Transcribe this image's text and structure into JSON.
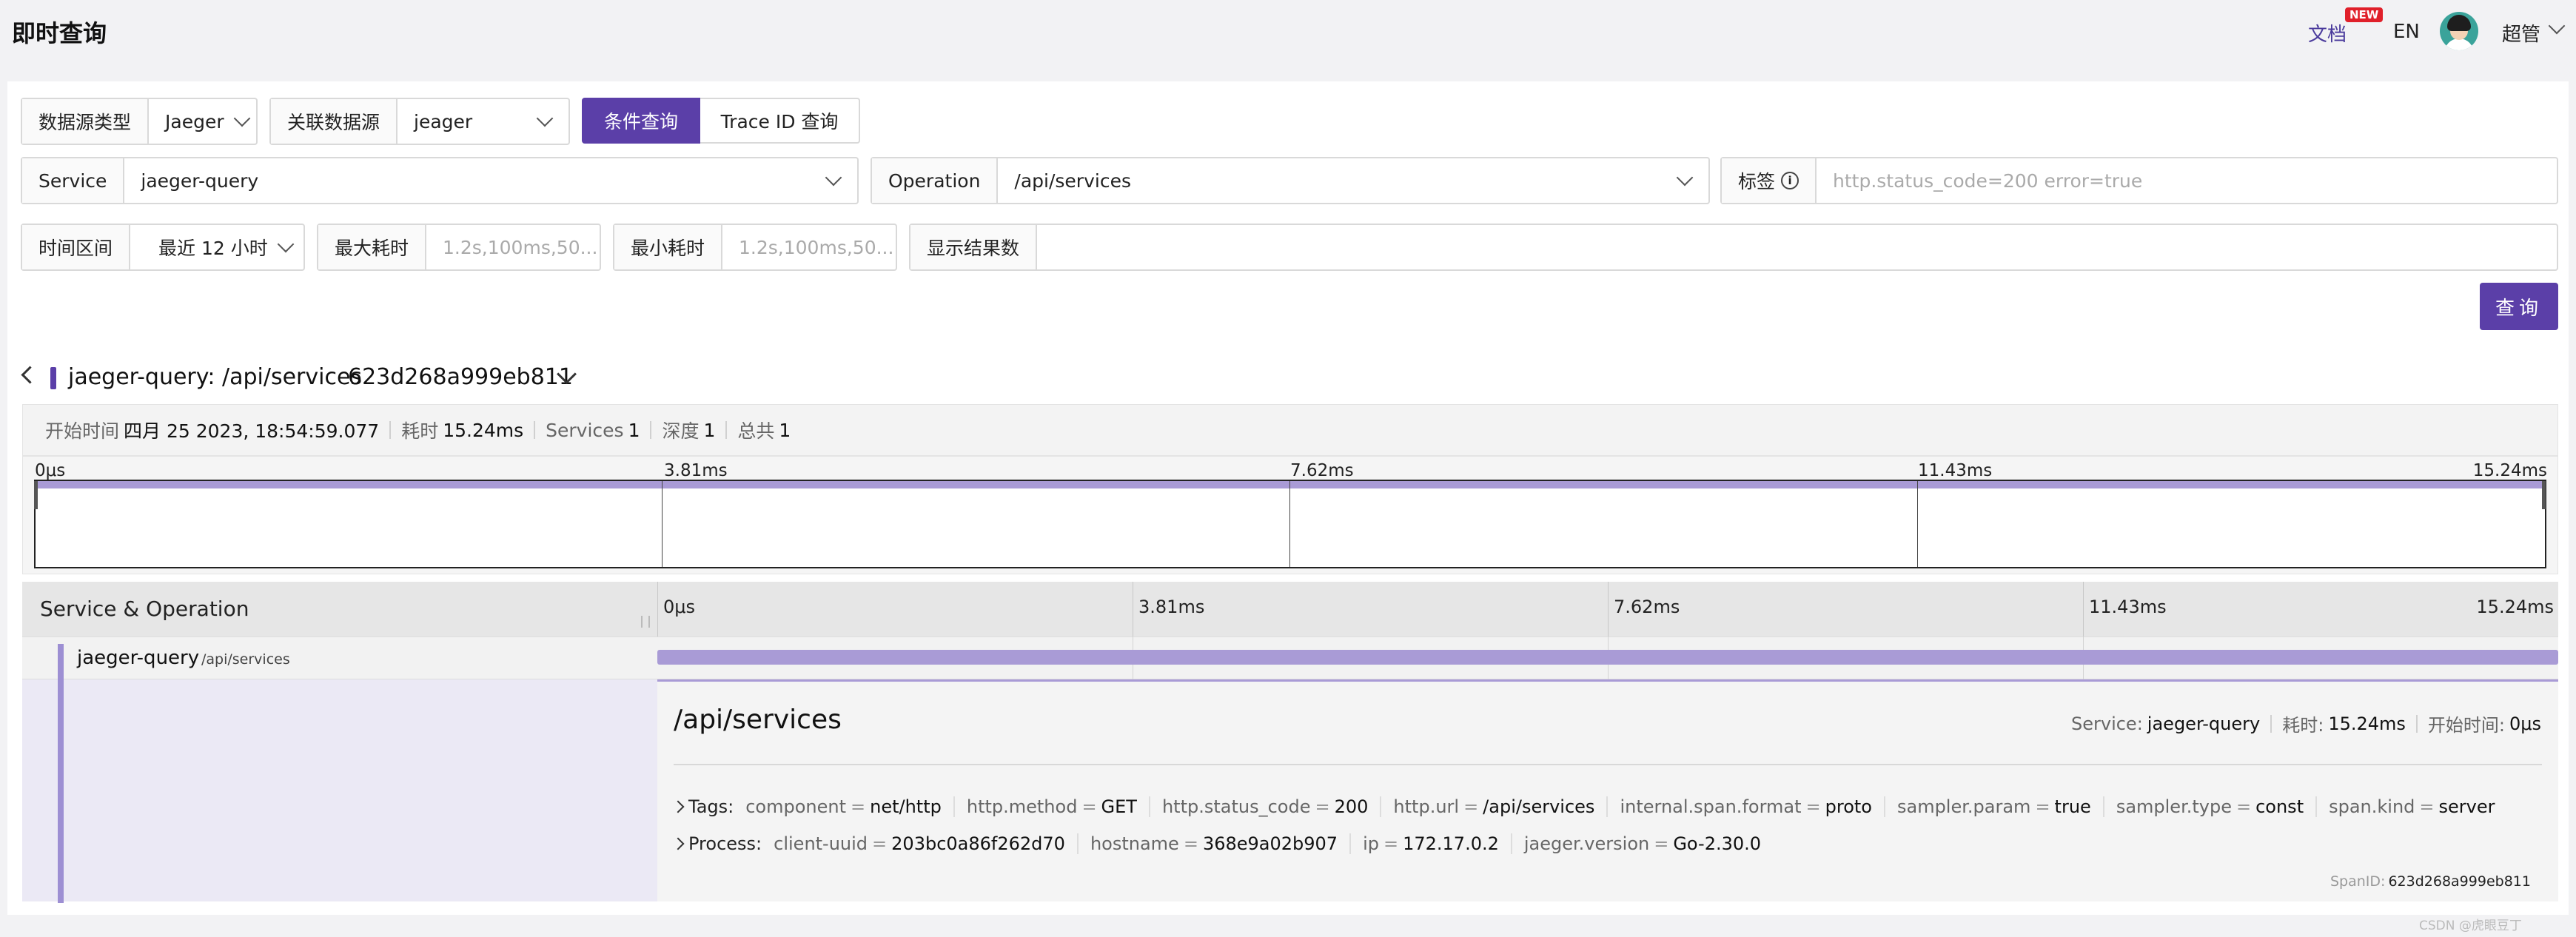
{
  "header": {
    "title": "即时查询",
    "docs": "文档",
    "docs_badge": "NEW",
    "lang": "EN",
    "username": "超管"
  },
  "filters": {
    "datasource_type": {
      "label": "数据源类型",
      "value": "Jaeger"
    },
    "linked_datasource": {
      "label": "关联数据源",
      "value": "jeager"
    },
    "mode_tabs": [
      "条件查询",
      "Trace ID 查询"
    ],
    "service": {
      "label": "Service",
      "value": "jaeger-query"
    },
    "operation": {
      "label": "Operation",
      "value": "/api/services"
    },
    "tags": {
      "label": "标签",
      "info": "i",
      "placeholder": "http.status_code=200 error=true"
    },
    "time_range": {
      "label": "时间区间",
      "value": "最近 12 小时"
    },
    "max_duration": {
      "label": "最大耗时",
      "placeholder": "1.2s,100ms,50..."
    },
    "min_duration": {
      "label": "最小耗时",
      "placeholder": "1.2s,100ms,50..."
    },
    "result_limit": {
      "label": "显示结果数",
      "value": ""
    },
    "query_button": "查询"
  },
  "trace": {
    "title": "jaeger-query: /api/services",
    "trace_id": "623d268a999eb811",
    "summary": {
      "start_label": "开始时间",
      "start_value": "四月 25 2023, 18:54:59.077",
      "duration_label": "耗时",
      "duration_value": "15.24ms",
      "services_label": "Services",
      "services_value": "1",
      "depth_label": "深度",
      "depth_value": "1",
      "total_label": "总共",
      "total_value": "1"
    },
    "ticks": [
      "0μs",
      "3.81ms",
      "7.62ms",
      "11.43ms",
      "15.24ms"
    ],
    "column_header": "Service & Operation",
    "span": {
      "service": "jaeger-query",
      "operation": "/api/services",
      "start_fraction": 0.0,
      "duration_fraction": 1.0
    },
    "detail": {
      "title": "/api/services",
      "service_label": "Service:",
      "service_value": "jaeger-query",
      "duration_label": "耗时:",
      "duration_value": "15.24ms",
      "start_label": "开始时间:",
      "start_value": "0μs",
      "tags_label": "Tags:",
      "tags": [
        {
          "k": "component",
          "v": "net/http"
        },
        {
          "k": "http.method",
          "v": "GET"
        },
        {
          "k": "http.status_code",
          "v": "200"
        },
        {
          "k": "http.url",
          "v": "/api/services"
        },
        {
          "k": "internal.span.format",
          "v": "proto"
        },
        {
          "k": "sampler.param",
          "v": "true"
        },
        {
          "k": "sampler.type",
          "v": "const"
        },
        {
          "k": "span.kind",
          "v": "server"
        }
      ],
      "process_label": "Process:",
      "process": [
        {
          "k": "client-uuid",
          "v": "203bc0a86f262d70"
        },
        {
          "k": "hostname",
          "v": "368e9a02b907"
        },
        {
          "k": "ip",
          "v": "172.17.0.2"
        },
        {
          "k": "jaeger.version",
          "v": "Go-2.30.0"
        }
      ],
      "span_id_label": "SpanID:",
      "span_id_value": "623d268a999eb811"
    }
  },
  "watermark": "CSDN @虎眼豆丁",
  "colors": {
    "accent": "#5b3fa8",
    "span_bar": "#a99bd6",
    "badge": "#e0202a"
  }
}
